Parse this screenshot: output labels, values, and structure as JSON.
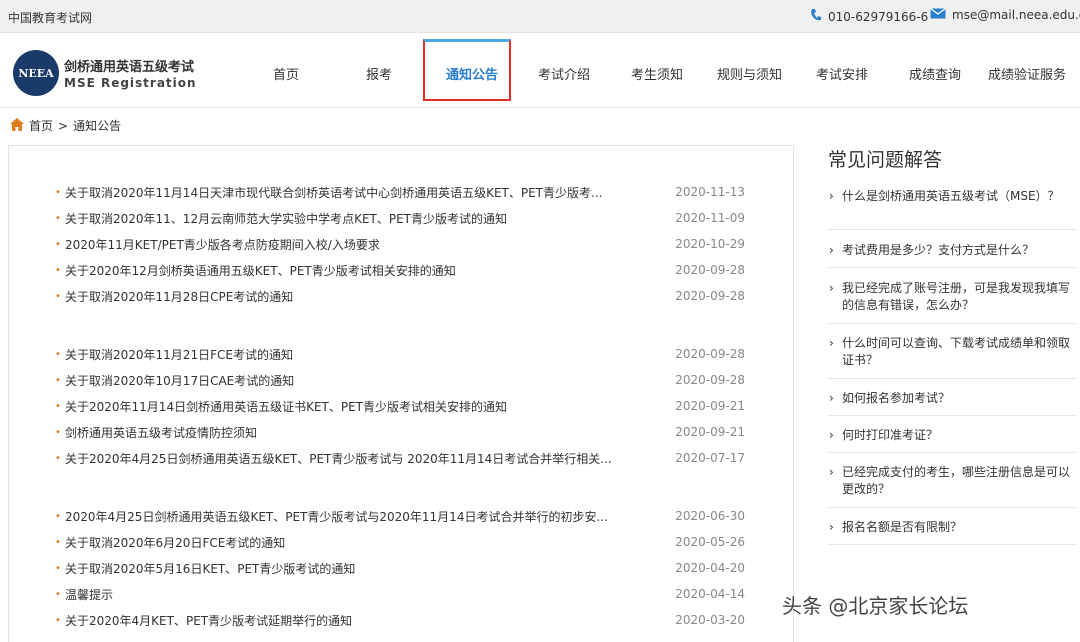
{
  "topbar": {
    "site_name": "中国教育考试网",
    "phone": "010-62979166-6",
    "email": "mse@mail.neea.edu.cn",
    "phone_icon": "phone-icon",
    "email_icon": "envelope-icon"
  },
  "header": {
    "logo_text": "NEEA",
    "brand_cn": "剑桥通用英语五级考试",
    "brand_en": "MSE Registration",
    "nav": [
      {
        "label": "首页"
      },
      {
        "label": "报考"
      },
      {
        "label": "通知公告",
        "active": true
      },
      {
        "label": "考试介绍"
      },
      {
        "label": "考生须知"
      },
      {
        "label": "规则与须知"
      },
      {
        "label": "考试安排"
      },
      {
        "label": "成绩查询"
      },
      {
        "label": "成绩验证服务"
      }
    ]
  },
  "breadcrumb": {
    "home": "首页",
    "separator": ">",
    "current": "通知公告",
    "home_icon": "home-icon"
  },
  "notices": [
    {
      "title": "关于取消2020年11月14日天津市现代联合剑桥英语考试中心剑桥通用英语五级KET、PET青少版考...",
      "date": "2020-11-13"
    },
    {
      "title": "关于取消2020年11、12月云南师范大学实验中学考点KET、PET青少版考试的通知",
      "date": "2020-11-09"
    },
    {
      "title": "2020年11月KET/PET青少版各考点防疫期间入校/入场要求",
      "date": "2020-10-29"
    },
    {
      "title": "关于2020年12月剑桥英语通用五级KET、PET青少版考试相关安排的通知",
      "date": "2020-09-28"
    },
    {
      "title": "关于取消2020年11月28日CPE考试的通知",
      "date": "2020-09-28"
    },
    {
      "title": "关于取消2020年11月21日FCE考试的通知",
      "date": "2020-09-28"
    },
    {
      "title": "关于取消2020年10月17日CAE考试的通知",
      "date": "2020-09-28"
    },
    {
      "title": "关于2020年11月14日剑桥通用英语五级证书KET、PET青少版考试相关安排的通知",
      "date": "2020-09-21"
    },
    {
      "title": "剑桥通用英语五级考试疫情防控须知",
      "date": "2020-09-21"
    },
    {
      "title": "关于2020年4月25日剑桥通用英语五级KET、PET青少版考试与 2020年11月14日考试合并举行相关...",
      "date": "2020-07-17"
    },
    {
      "title": "2020年4月25日剑桥通用英语五级KET、PET青少版考试与2020年11月14日考试合并举行的初步安...",
      "date": "2020-06-30"
    },
    {
      "title": "关于取消2020年6月20日FCE考试的通知",
      "date": "2020-05-26"
    },
    {
      "title": "关于取消2020年5月16日KET、PET青少版考试的通知",
      "date": "2020-04-20"
    },
    {
      "title": "温馨提示",
      "date": "2020-04-14"
    },
    {
      "title": "关于2020年4月KET、PET青少版考试延期举行的通知",
      "date": "2020-03-20"
    }
  ],
  "faq": {
    "title": "常见问题解答",
    "items": [
      {
        "q": "什么是剑桥通用英语五级考试（MSE）？"
      },
      {
        "q": "考试费用是多少？支付方式是什么？"
      },
      {
        "q": "我已经完成了账号注册，可是我发现我填写的信息有错误，怎么办？"
      },
      {
        "q": "什么时间可以查询、下载考试成绩单和领取证书？"
      },
      {
        "q": "如何报名参加考试？"
      },
      {
        "q": "何时打印准考证？"
      },
      {
        "q": "已经完成支付的考生，哪些注册信息是可以更改的？"
      },
      {
        "q": "报名名额是否有限制？"
      }
    ]
  },
  "watermark": "头条 @北京家长论坛",
  "colors": {
    "active_nav": "#2a7fcc",
    "highlight_border": "#e32b2b",
    "bullet": "#e07d1d",
    "date": "#888888"
  }
}
